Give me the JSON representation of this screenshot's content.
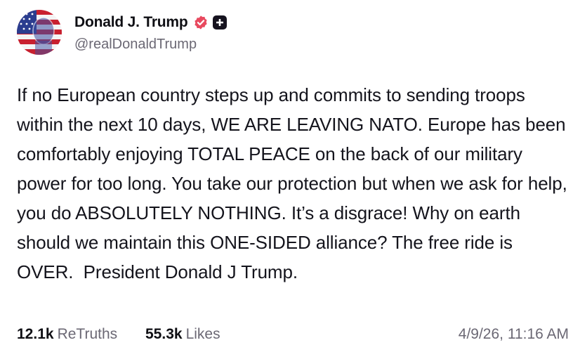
{
  "author": {
    "display_name": "Donald J. Trump",
    "handle": "@realDonaldTrump",
    "verified": true,
    "avatar_icon": "flag-portrait-avatar"
  },
  "post": {
    "text": "If no European country steps up and commits to sending troops within the next 10 days, WE ARE LEAVING NATO. Europe has been comfortably enjoying TOTAL PEACE on the back of our military power for too long. You take our protection but when we ask for help, you do ABSOLUTELY NOTHING. It’s a disgrace! Why on earth should we maintain this ONE-SIDED alliance? The free ride is OVER.  President Donald J Trump."
  },
  "stats": {
    "retruths_count": "12.1k",
    "retruths_label": "ReTruths",
    "likes_count": "55.3k",
    "likes_label": "Likes",
    "timestamp": "4/9/26, 11:16 AM"
  },
  "colors": {
    "verified_badge": "#e8495f",
    "plus_badge": "#16131f",
    "muted_text": "#6b6874"
  }
}
